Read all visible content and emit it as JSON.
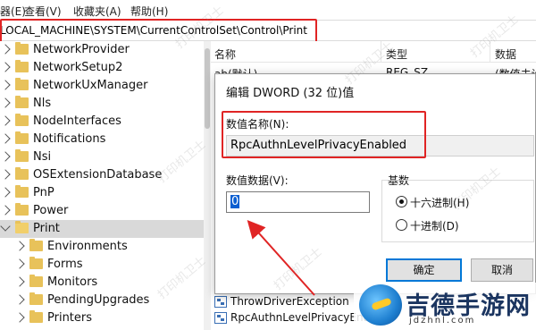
{
  "menubar": {
    "items": [
      "器(E)",
      "查看(V)",
      "收藏夹(A)",
      "帮助(H)"
    ]
  },
  "address": {
    "path": "LOCAL_MACHINE\\SYSTEM\\CurrentControlSet\\Control\\Print"
  },
  "tree": {
    "items": [
      {
        "label": "NetworkProvider",
        "expanded": false,
        "level": 0
      },
      {
        "label": "NetworkSetup2",
        "expanded": false,
        "level": 0
      },
      {
        "label": "NetworkUxManager",
        "expanded": false,
        "level": 0
      },
      {
        "label": "Nls",
        "expanded": false,
        "level": 0
      },
      {
        "label": "NodeInterfaces",
        "expanded": false,
        "level": 0
      },
      {
        "label": "Notifications",
        "expanded": false,
        "level": 0
      },
      {
        "label": "Nsi",
        "expanded": false,
        "level": 0
      },
      {
        "label": "OSExtensionDatabase",
        "expanded": false,
        "level": 0
      },
      {
        "label": "PnP",
        "expanded": false,
        "level": 0
      },
      {
        "label": "Power",
        "expanded": false,
        "level": 0
      },
      {
        "label": "Print",
        "expanded": true,
        "level": 0,
        "selected": true
      },
      {
        "label": "Environments",
        "expanded": false,
        "level": 1
      },
      {
        "label": "Forms",
        "expanded": false,
        "level": 1
      },
      {
        "label": "Monitors",
        "expanded": false,
        "level": 1
      },
      {
        "label": "PendingUpgrades",
        "expanded": false,
        "level": 1
      },
      {
        "label": "Printers",
        "expanded": false,
        "level": 1
      }
    ]
  },
  "list": {
    "columns": {
      "name": "名称",
      "type": "类型",
      "data": "数据"
    },
    "rows": [
      {
        "icon": "string-value-icon",
        "name": "ab(默认)",
        "type": "REG_SZ",
        "data": "(数值未设"
      },
      {
        "icon": "dword-value-icon",
        "name": "ThrowDriverException",
        "type": "",
        "data": ""
      },
      {
        "icon": "dword-value-icon",
        "name": "RpcAuthnLevelPrivacyEnabled",
        "type": "",
        "data": ""
      }
    ]
  },
  "dialog": {
    "title": "编辑 DWORD (32 位)值",
    "value_name_label": "数值名称(N):",
    "value_name": "RpcAuthnLevelPrivacyEnabled",
    "value_data_label": "数值数据(V):",
    "value_data": "0",
    "base_label": "基数",
    "radio_hex": "十六进制(H)",
    "radio_dec": "十进制(D)",
    "base_selected": "hex",
    "ok": "确定",
    "cancel": "取消"
  },
  "logo": {
    "title": "吉德手游网",
    "domain": "jdzhnl.com"
  },
  "watermark_text": "打印机卫士",
  "colors": {
    "highlight_red": "#e02424",
    "selection_blue": "#0b5fd1",
    "folder_yellow": "#e8c25a"
  }
}
